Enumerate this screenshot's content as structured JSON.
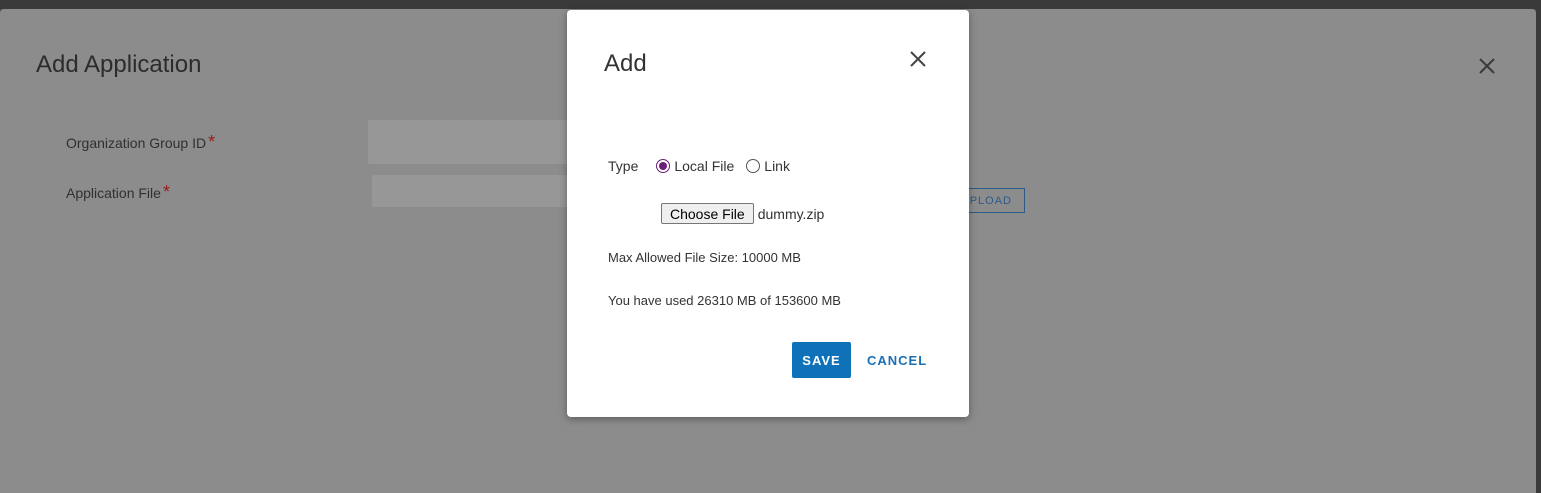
{
  "background": {
    "title": "Add Application",
    "fields": [
      {
        "label": "Organization Group ID",
        "required_mark": "*"
      },
      {
        "label": "Application File",
        "required_mark": "*"
      }
    ],
    "upload_label": "UPLOAD"
  },
  "modal": {
    "title": "Add",
    "type_label": "Type",
    "options": [
      {
        "label": "Local File",
        "selected": true
      },
      {
        "label": "Link",
        "selected": false
      }
    ],
    "choose_file_label": "Choose File",
    "chosen_file": "dummy.zip",
    "max_size_text": "Max Allowed File Size: 10000 MB",
    "usage_text": "You have used 26310 MB of 153600 MB",
    "save_label": "SAVE",
    "cancel_label": "CANCEL"
  },
  "colors": {
    "primary": "#0f72b8",
    "radio_selected": "#6b1f7a",
    "required": "#9b1c1c"
  }
}
